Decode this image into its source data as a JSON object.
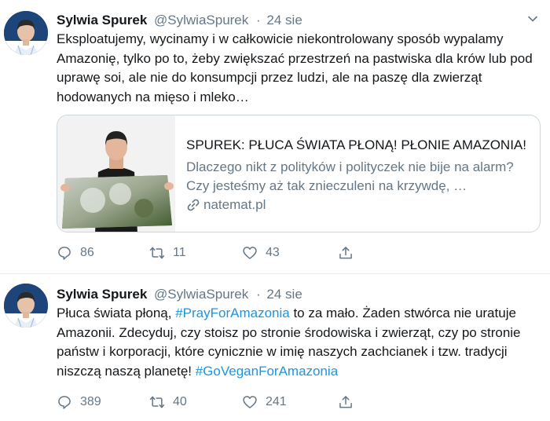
{
  "tweets": [
    {
      "author": "Sylwia Spurek",
      "handle": "@SylwiaSpurek",
      "separator": "·",
      "date": "24 sie",
      "text": "Eksploatujemy, wycinamy i w całkowicie niekontrolowany sposób wypalamy Amazonię, tylko po to, żeby zwiększać przestrzeń na pastwiska dla krów lub pod uprawę soi, ale nie do konsumpcji przez ludzi, ale na paszę dla zwierząt hodowanych na mięso i mleko…",
      "card": {
        "title": "SPUREK: PŁUCA ŚWIATA PŁONĄ! PŁONIE AMAZONIA!",
        "description": "Dlaczego nikt z polityków i polityczek nie bije na alarm? Czy jesteśmy aż tak znieczuleni na krzywdę, …",
        "domain": "natemat.pl",
        "link_icon": "link-icon"
      },
      "replies": "86",
      "retweets": "11",
      "likes": "43"
    },
    {
      "author": "Sylwia Spurek",
      "handle": "@SylwiaSpurek",
      "separator": "·",
      "date": "24 sie",
      "text_parts": {
        "p1": "Płuca świata płoną, ",
        "hashtag1": "#PrayForAmazonia",
        "p2": " to za mało. Żaden stwórca nie uratuje Amazonii. Zdecyduj, czy stoisz po stronie środowiska i zwierząt, czy po stronie państw i korporacji, które cynicznie w imię naszych zachcianek i tzw. tradycji niszczą naszą planetę! ",
        "hashtag2": "#GoVeganForAmazonia"
      },
      "replies": "389",
      "retweets": "40",
      "likes": "241"
    }
  ],
  "icons": {
    "reply": "reply-icon",
    "retweet": "retweet-icon",
    "like": "heart-icon",
    "share": "share-icon",
    "menu": "chevron-down-icon"
  },
  "colors": {
    "link": "#1b95e0",
    "secondary_text": "#657786",
    "border": "#e6ecf0"
  }
}
